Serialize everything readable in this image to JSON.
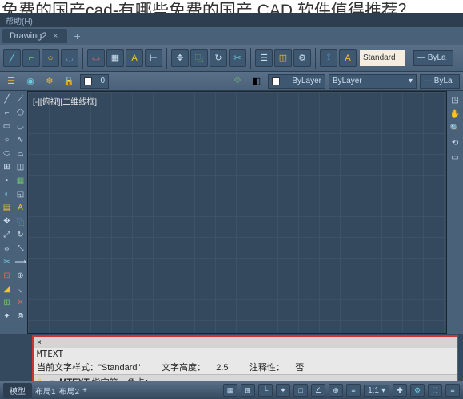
{
  "page_title": "免费的国产cad-有哪些免费的国产 CAD 软件值得推荐？",
  "menu": {
    "help": "帮助(H)"
  },
  "doc_tab": {
    "name": "Drawing2",
    "close": "×",
    "add": "+"
  },
  "ribbon": {
    "standard": "Standard",
    "bylayer_dash": "— ByLa",
    "zero": "0"
  },
  "props": {
    "bylayer1": "ByLayer",
    "bylayer2": "ByLayer",
    "bylayer3": "— ByLa"
  },
  "canvas": {
    "view_label": "[-][俯视][二维线框]"
  },
  "command": {
    "header": "×",
    "name": "MTEXT",
    "info_prefix": "当前文字样式：",
    "style_q": "\"Standard\"",
    "height_label": "文字高度：",
    "height_val": "2.5",
    "anno_label": "注释性：",
    "anno_val": "否",
    "prompt_label": "MTEXT",
    "prompt_text": "指定第一角点："
  },
  "status": {
    "model": "模型",
    "layout1": "布局1",
    "layout2": "布局2",
    "scale": "1:1"
  }
}
